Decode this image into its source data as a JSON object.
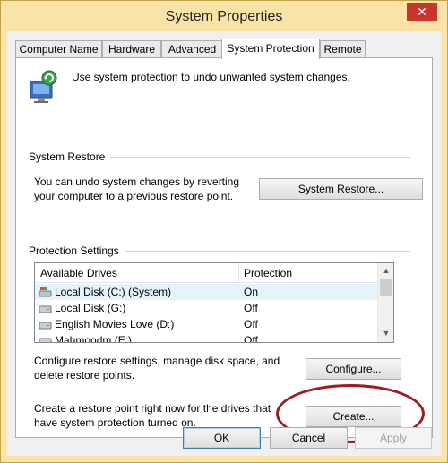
{
  "window": {
    "title": "System Properties",
    "close_glyph": "✕"
  },
  "tabs": [
    {
      "label": "Computer Name"
    },
    {
      "label": "Hardware"
    },
    {
      "label": "Advanced"
    },
    {
      "label": "System Protection"
    },
    {
      "label": "Remote"
    }
  ],
  "active_tab": "System Protection",
  "intro": {
    "text": "Use system protection to undo unwanted system changes.",
    "icon": "system-protection-shield-icon"
  },
  "system_restore": {
    "heading": "System Restore",
    "description_line1": "You can undo system changes by reverting",
    "description_line2": "your computer to a previous restore point.",
    "button_label": "System Restore..."
  },
  "protection_settings": {
    "heading": "Protection Settings",
    "columns": [
      "Available Drives",
      "Protection"
    ],
    "drives": [
      {
        "name": "Local Disk (C:) (System)",
        "protection": "On",
        "icon": "system-drive-icon",
        "selected": true
      },
      {
        "name": "Local Disk (G:)",
        "protection": "Off",
        "icon": "drive-icon",
        "selected": false
      },
      {
        "name": "English Movies Love (D:)",
        "protection": "Off",
        "icon": "drive-icon",
        "selected": false
      },
      {
        "name": "Mahmoodm (E:)",
        "protection": "Off",
        "icon": "drive-icon",
        "selected": false
      }
    ],
    "configure_line1": "Configure restore settings, manage disk space, and",
    "configure_line2": "delete restore points.",
    "configure_button": "Configure...",
    "create_line1": "Create a restore point right now for the drives that",
    "create_line2": "have system protection turned on.",
    "create_button": "Create..."
  },
  "footer": {
    "ok": "OK",
    "cancel": "Cancel",
    "apply": "Apply"
  },
  "colors": {
    "title_bar": "#f9e3a6",
    "close_button": "#c7352c",
    "highlight_ellipse": "#9c1c20",
    "selected_row": "#e5f3fb"
  }
}
